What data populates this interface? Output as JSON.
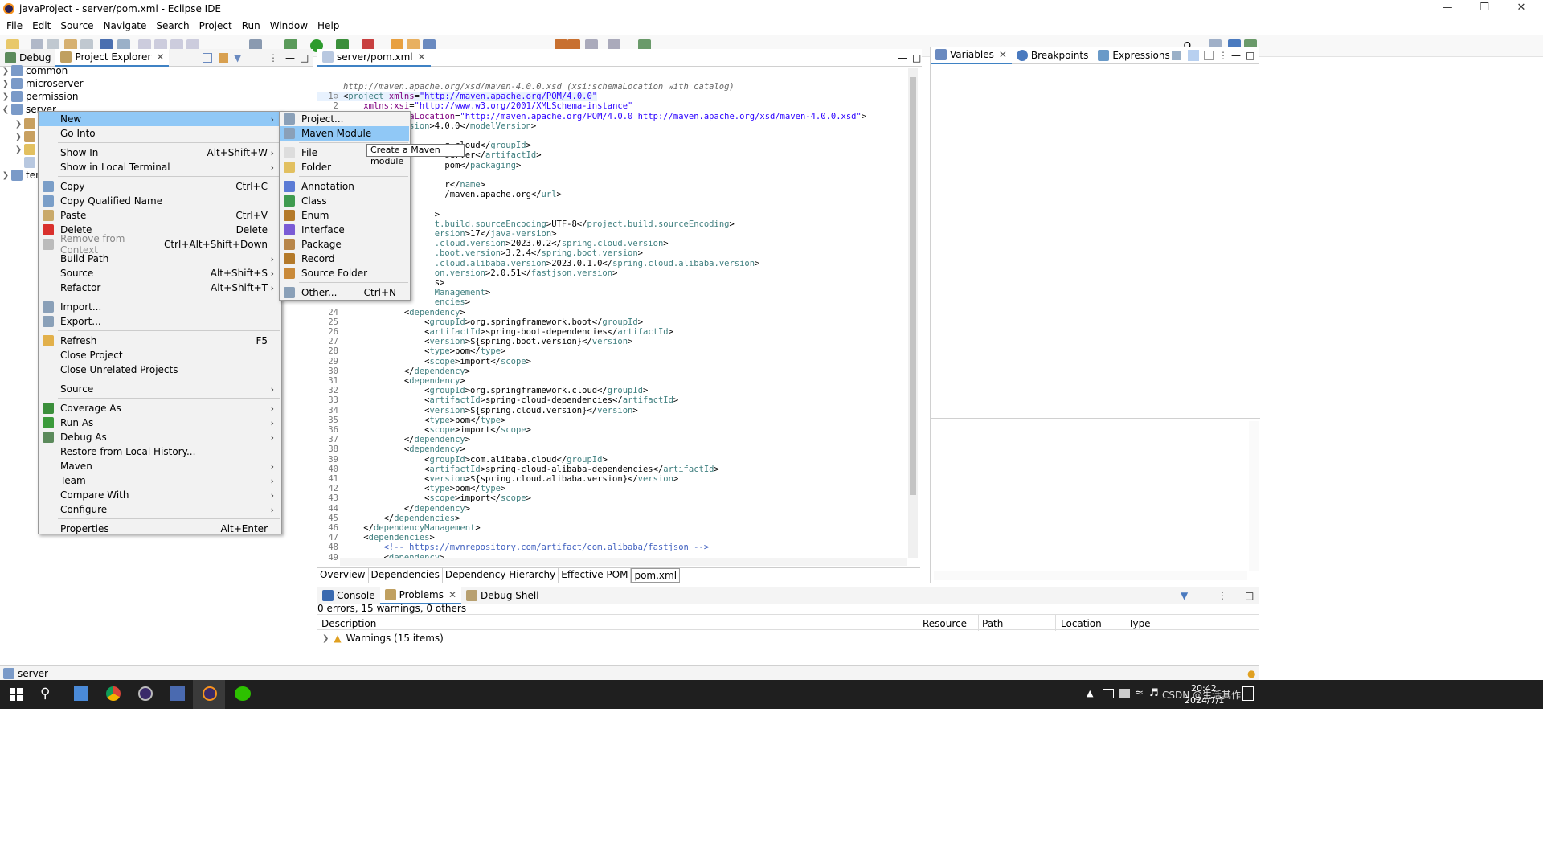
{
  "window": {
    "title": "javaProject - server/pom.xml - Eclipse IDE"
  },
  "menubar": [
    "File",
    "Edit",
    "Source",
    "Navigate",
    "Search",
    "Project",
    "Run",
    "Window",
    "Help"
  ],
  "left_panel": {
    "tabs": [
      "Debug",
      "Project Explorer"
    ],
    "tree": [
      "common",
      "microserver",
      "permission",
      "server",
      "ter"
    ]
  },
  "editor": {
    "tab": "server/pom.xml",
    "lines": [
      {
        "n": "",
        "segs": [
          [
            "hd",
            "http://maven.apache.org/xsd/maven-4.0.0.xsd (xsi:schemaLocation with catalog)"
          ]
        ]
      },
      {
        "n": "1⊖",
        "segs": [
          [
            "tx",
            "<"
          ],
          [
            "tg",
            "project"
          ],
          [
            "tx",
            " "
          ],
          [
            "at",
            "xmlns"
          ],
          [
            "tx",
            "="
          ],
          [
            "av",
            "\"http://maven.apache.org/POM/4.0.0\""
          ]
        ]
      },
      {
        "n": "2",
        "segs": [
          [
            "tx",
            "    "
          ],
          [
            "at",
            "xmlns:xsi"
          ],
          [
            "tx",
            "="
          ],
          [
            "av",
            "\"http://www.w3.org/2001/XMLSchema-instance\""
          ]
        ]
      },
      {
        "n": "3",
        "segs": [
          [
            "tx",
            "    "
          ],
          [
            "at",
            "xsi:schemaLocation"
          ],
          [
            "tx",
            "="
          ],
          [
            "av",
            "\"http://maven.apache.org/POM/4.0.0 http://maven.apache.org/xsd/maven-4.0.0.xsd\""
          ],
          [
            "tx",
            ">"
          ]
        ]
      },
      {
        "n": "4",
        "segs": [
          [
            "tx",
            "    <"
          ],
          [
            "tg",
            "modelVersion"
          ],
          [
            "tx",
            ">4.0.0</"
          ],
          [
            "tg",
            "modelVersion"
          ],
          [
            "tx",
            ">"
          ]
        ]
      },
      {
        "n": "",
        "segs": []
      },
      {
        "n": "",
        "segs": [
          [
            "tx",
            "                    g.cloud</"
          ],
          [
            "tg",
            "groupId"
          ],
          [
            "tx",
            ">"
          ]
        ]
      },
      {
        "n": "",
        "segs": [
          [
            "tx",
            "                    server</"
          ],
          [
            "tg",
            "artifactId"
          ],
          [
            "tx",
            ">"
          ]
        ]
      },
      {
        "n": "",
        "segs": [
          [
            "tx",
            "                    pom</"
          ],
          [
            "tg",
            "packaging"
          ],
          [
            "tx",
            ">"
          ]
        ]
      },
      {
        "n": "",
        "segs": []
      },
      {
        "n": "",
        "segs": [
          [
            "tx",
            "                    r</"
          ],
          [
            "tg",
            "name"
          ],
          [
            "tx",
            ">"
          ]
        ]
      },
      {
        "n": "",
        "segs": [
          [
            "tx",
            "                    /maven.apache.org</"
          ],
          [
            "tg",
            "url"
          ],
          [
            "tx",
            ">"
          ]
        ]
      },
      {
        "n": "",
        "segs": []
      },
      {
        "n": "",
        "segs": [
          [
            "tx",
            "                  >"
          ]
        ]
      },
      {
        "n": "",
        "segs": [
          [
            "tg",
            "                  t.build.sourceEncoding"
          ],
          [
            "tx",
            ">UTF-8</"
          ],
          [
            "tg",
            "project.build.sourceEncoding"
          ],
          [
            "tx",
            ">"
          ]
        ]
      },
      {
        "n": "",
        "segs": [
          [
            "tg",
            "                  ersion"
          ],
          [
            "tx",
            ">17</"
          ],
          [
            "tg",
            "java-version"
          ],
          [
            "tx",
            ">"
          ]
        ]
      },
      {
        "n": "",
        "segs": [
          [
            "tg",
            "                  .cloud.version"
          ],
          [
            "tx",
            ">2023.0.2</"
          ],
          [
            "tg",
            "spring.cloud.version"
          ],
          [
            "tx",
            ">"
          ]
        ]
      },
      {
        "n": "",
        "segs": [
          [
            "tg",
            "                  .boot.version"
          ],
          [
            "tx",
            ">3.2.4</"
          ],
          [
            "tg",
            "spring.boot.version"
          ],
          [
            "tx",
            ">"
          ]
        ]
      },
      {
        "n": "",
        "segs": [
          [
            "tg",
            "                  .cloud.alibaba.version"
          ],
          [
            "tx",
            ">2023.0.1.0</"
          ],
          [
            "tg",
            "spring.cloud.alibaba.version"
          ],
          [
            "tx",
            ">"
          ]
        ]
      },
      {
        "n": "",
        "segs": [
          [
            "tg",
            "                  on.version"
          ],
          [
            "tx",
            ">2.0.51</"
          ],
          [
            "tg",
            "fastjson.version"
          ],
          [
            "tx",
            ">"
          ]
        ]
      },
      {
        "n": "",
        "segs": [
          [
            "tx",
            "                  s>"
          ]
        ]
      },
      {
        "n": "",
        "segs": [
          [
            "tg",
            "                  Management"
          ],
          [
            "tx",
            ">"
          ]
        ]
      },
      {
        "n": "",
        "segs": [
          [
            "tg",
            "                  encies"
          ],
          [
            "tx",
            ">"
          ]
        ]
      },
      {
        "n": "24",
        "segs": [
          [
            "tx",
            "            <"
          ],
          [
            "tg",
            "dependency"
          ],
          [
            "tx",
            ">"
          ]
        ]
      },
      {
        "n": "25",
        "segs": [
          [
            "tx",
            "                <"
          ],
          [
            "tg",
            "groupId"
          ],
          [
            "tx",
            ">org.springframework.boot</"
          ],
          [
            "tg",
            "groupId"
          ],
          [
            "tx",
            ">"
          ]
        ]
      },
      {
        "n": "26",
        "segs": [
          [
            "tx",
            "                <"
          ],
          [
            "tg",
            "artifactId"
          ],
          [
            "tx",
            ">spring-boot-dependencies</"
          ],
          [
            "tg",
            "artifactId"
          ],
          [
            "tx",
            ">"
          ]
        ]
      },
      {
        "n": "27",
        "segs": [
          [
            "tx",
            "                <"
          ],
          [
            "tg",
            "version"
          ],
          [
            "tx",
            ">${spring.boot.version}</"
          ],
          [
            "tg",
            "version"
          ],
          [
            "tx",
            ">"
          ]
        ]
      },
      {
        "n": "28",
        "segs": [
          [
            "tx",
            "                <"
          ],
          [
            "tg",
            "type"
          ],
          [
            "tx",
            ">pom</"
          ],
          [
            "tg",
            "type"
          ],
          [
            "tx",
            ">"
          ]
        ]
      },
      {
        "n": "29",
        "segs": [
          [
            "tx",
            "                <"
          ],
          [
            "tg",
            "scope"
          ],
          [
            "tx",
            ">import</"
          ],
          [
            "tg",
            "scope"
          ],
          [
            "tx",
            ">"
          ]
        ]
      },
      {
        "n": "30",
        "segs": [
          [
            "tx",
            "            </"
          ],
          [
            "tg",
            "dependency"
          ],
          [
            "tx",
            ">"
          ]
        ]
      },
      {
        "n": "31",
        "segs": [
          [
            "tx",
            "            <"
          ],
          [
            "tg",
            "dependency"
          ],
          [
            "tx",
            ">"
          ]
        ]
      },
      {
        "n": "32",
        "segs": [
          [
            "tx",
            "                <"
          ],
          [
            "tg",
            "groupId"
          ],
          [
            "tx",
            ">org.springframework.cloud</"
          ],
          [
            "tg",
            "groupId"
          ],
          [
            "tx",
            ">"
          ]
        ]
      },
      {
        "n": "33",
        "segs": [
          [
            "tx",
            "                <"
          ],
          [
            "tg",
            "artifactId"
          ],
          [
            "tx",
            ">spring-cloud-dependencies</"
          ],
          [
            "tg",
            "artifactId"
          ],
          [
            "tx",
            ">"
          ]
        ]
      },
      {
        "n": "34",
        "segs": [
          [
            "tx",
            "                <"
          ],
          [
            "tg",
            "version"
          ],
          [
            "tx",
            ">${spring.cloud.version}</"
          ],
          [
            "tg",
            "version"
          ],
          [
            "tx",
            ">"
          ]
        ]
      },
      {
        "n": "35",
        "segs": [
          [
            "tx",
            "                <"
          ],
          [
            "tg",
            "type"
          ],
          [
            "tx",
            ">pom</"
          ],
          [
            "tg",
            "type"
          ],
          [
            "tx",
            ">"
          ]
        ]
      },
      {
        "n": "36",
        "segs": [
          [
            "tx",
            "                <"
          ],
          [
            "tg",
            "scope"
          ],
          [
            "tx",
            ">import</"
          ],
          [
            "tg",
            "scope"
          ],
          [
            "tx",
            ">"
          ]
        ]
      },
      {
        "n": "37",
        "segs": [
          [
            "tx",
            "            </"
          ],
          [
            "tg",
            "dependency"
          ],
          [
            "tx",
            ">"
          ]
        ]
      },
      {
        "n": "38",
        "segs": [
          [
            "tx",
            "            <"
          ],
          [
            "tg",
            "dependency"
          ],
          [
            "tx",
            ">"
          ]
        ]
      },
      {
        "n": "39",
        "segs": [
          [
            "tx",
            "                <"
          ],
          [
            "tg",
            "groupId"
          ],
          [
            "tx",
            ">com.alibaba.cloud</"
          ],
          [
            "tg",
            "groupId"
          ],
          [
            "tx",
            ">"
          ]
        ]
      },
      {
        "n": "40",
        "segs": [
          [
            "tx",
            "                <"
          ],
          [
            "tg",
            "artifactId"
          ],
          [
            "tx",
            ">spring-cloud-alibaba-dependencies</"
          ],
          [
            "tg",
            "artifactId"
          ],
          [
            "tx",
            ">"
          ]
        ]
      },
      {
        "n": "41",
        "segs": [
          [
            "tx",
            "                <"
          ],
          [
            "tg",
            "version"
          ],
          [
            "tx",
            ">${spring.cloud.alibaba.version}</"
          ],
          [
            "tg",
            "version"
          ],
          [
            "tx",
            ">"
          ]
        ]
      },
      {
        "n": "42",
        "segs": [
          [
            "tx",
            "                <"
          ],
          [
            "tg",
            "type"
          ],
          [
            "tx",
            ">pom</"
          ],
          [
            "tg",
            "type"
          ],
          [
            "tx",
            ">"
          ]
        ]
      },
      {
        "n": "43",
        "segs": [
          [
            "tx",
            "                <"
          ],
          [
            "tg",
            "scope"
          ],
          [
            "tx",
            ">import</"
          ],
          [
            "tg",
            "scope"
          ],
          [
            "tx",
            ">"
          ]
        ]
      },
      {
        "n": "44",
        "segs": [
          [
            "tx",
            "            </"
          ],
          [
            "tg",
            "dependency"
          ],
          [
            "tx",
            ">"
          ]
        ]
      },
      {
        "n": "45",
        "segs": [
          [
            "tx",
            "        </"
          ],
          [
            "tg",
            "dependencies"
          ],
          [
            "tx",
            ">"
          ]
        ]
      },
      {
        "n": "46",
        "segs": [
          [
            "tx",
            "    </"
          ],
          [
            "tg",
            "dependencyManagement"
          ],
          [
            "tx",
            ">"
          ]
        ]
      },
      {
        "n": "47",
        "segs": [
          [
            "tx",
            "    <"
          ],
          [
            "tg",
            "dependencies"
          ],
          [
            "tx",
            ">"
          ]
        ]
      },
      {
        "n": "48",
        "segs": [
          [
            "cm",
            "        <!-- https://mvnrepository.com/artifact/com.alibaba/fastjson -->"
          ]
        ]
      },
      {
        "n": "49",
        "segs": [
          [
            "tx",
            "        <"
          ],
          [
            "tg",
            "dependency"
          ],
          [
            "tx",
            ">"
          ]
        ]
      }
    ],
    "bottom_tabs": [
      "Overview",
      "Dependencies",
      "Dependency Hierarchy",
      "Effective POM",
      "pom.xml"
    ]
  },
  "right_panel": {
    "tabs": [
      "Variables",
      "Breakpoints",
      "Expressions"
    ]
  },
  "bottom_panel": {
    "tabs": [
      "Console",
      "Problems",
      "Debug Shell"
    ],
    "summary": "0 errors, 15 warnings, 0 others",
    "columns": [
      "Description",
      "Resource",
      "Path",
      "Location",
      "Type"
    ],
    "row": "Warnings (15 items)"
  },
  "status": "server",
  "context_menu": [
    {
      "label": "New",
      "sub": true,
      "hl": true
    },
    {
      "label": "Go Into"
    },
    {
      "sep": true
    },
    {
      "label": "Show In",
      "acc": "Alt+Shift+W",
      "sub": true
    },
    {
      "label": "Show in Local Terminal",
      "sub": true
    },
    {
      "sep": true
    },
    {
      "label": "Copy",
      "acc": "Ctrl+C",
      "icon": "#7a9ec8"
    },
    {
      "label": "Copy Qualified Name",
      "icon": "#7a9ec8"
    },
    {
      "label": "Paste",
      "acc": "Ctrl+V",
      "icon": "#c9a96a"
    },
    {
      "label": "Delete",
      "acc": "Delete",
      "icon": "#d9302c"
    },
    {
      "label": "Remove from Context",
      "acc": "Ctrl+Alt+Shift+Down",
      "dis": true,
      "icon": "#bbbbbb"
    },
    {
      "label": "Build Path",
      "sub": true
    },
    {
      "label": "Source",
      "acc": "Alt+Shift+S",
      "sub": true
    },
    {
      "label": "Refactor",
      "acc": "Alt+Shift+T",
      "sub": true
    },
    {
      "sep": true
    },
    {
      "label": "Import...",
      "icon": "#8aa0b8"
    },
    {
      "label": "Export...",
      "icon": "#8aa0b8"
    },
    {
      "sep": true
    },
    {
      "label": "Refresh",
      "acc": "F5",
      "icon": "#e2b04a"
    },
    {
      "label": "Close Project"
    },
    {
      "label": "Close Unrelated Projects"
    },
    {
      "sep": true
    },
    {
      "label": "Source",
      "sub": true
    },
    {
      "sep": true
    },
    {
      "label": "Coverage As",
      "sub": true,
      "icon": "#3b8f3b"
    },
    {
      "label": "Run As",
      "sub": true,
      "icon": "#3b9b3b"
    },
    {
      "label": "Debug As",
      "sub": true,
      "icon": "#5b8a5b"
    },
    {
      "label": "Restore from Local History..."
    },
    {
      "label": "Maven",
      "sub": true
    },
    {
      "label": "Team",
      "sub": true
    },
    {
      "label": "Compare With",
      "sub": true
    },
    {
      "label": "Configure",
      "sub": true
    },
    {
      "sep": true
    },
    {
      "label": "Properties",
      "acc": "Alt+Enter"
    }
  ],
  "submenu": [
    {
      "label": "Project...",
      "icon": "#8aa0b8"
    },
    {
      "label": "Maven Module",
      "hl": true,
      "icon": "#8aa0b8"
    },
    {
      "sep": true
    },
    {
      "label": "File",
      "icon": "#dddddd"
    },
    {
      "label": "Folder",
      "icon": "#e2c060"
    },
    {
      "sep": true
    },
    {
      "label": "Annotation",
      "icon": "#5b7bd5"
    },
    {
      "label": "Class",
      "icon": "#3f9b4f"
    },
    {
      "label": "Enum",
      "icon": "#b47a2a"
    },
    {
      "label": "Interface",
      "icon": "#7a5bd5"
    },
    {
      "label": "Package",
      "icon": "#b8864a"
    },
    {
      "label": "Record",
      "icon": "#b47a2a"
    },
    {
      "label": "Source Folder",
      "icon": "#c98a3a"
    },
    {
      "sep": true
    },
    {
      "label": "Other...",
      "acc": "Ctrl+N",
      "icon": "#8aa0b8"
    }
  ],
  "tooltip": "Create a Maven module",
  "taskbar": {
    "time": "20:42",
    "date": "2024/7/1",
    "watermark": "CSDN @生活其作"
  }
}
